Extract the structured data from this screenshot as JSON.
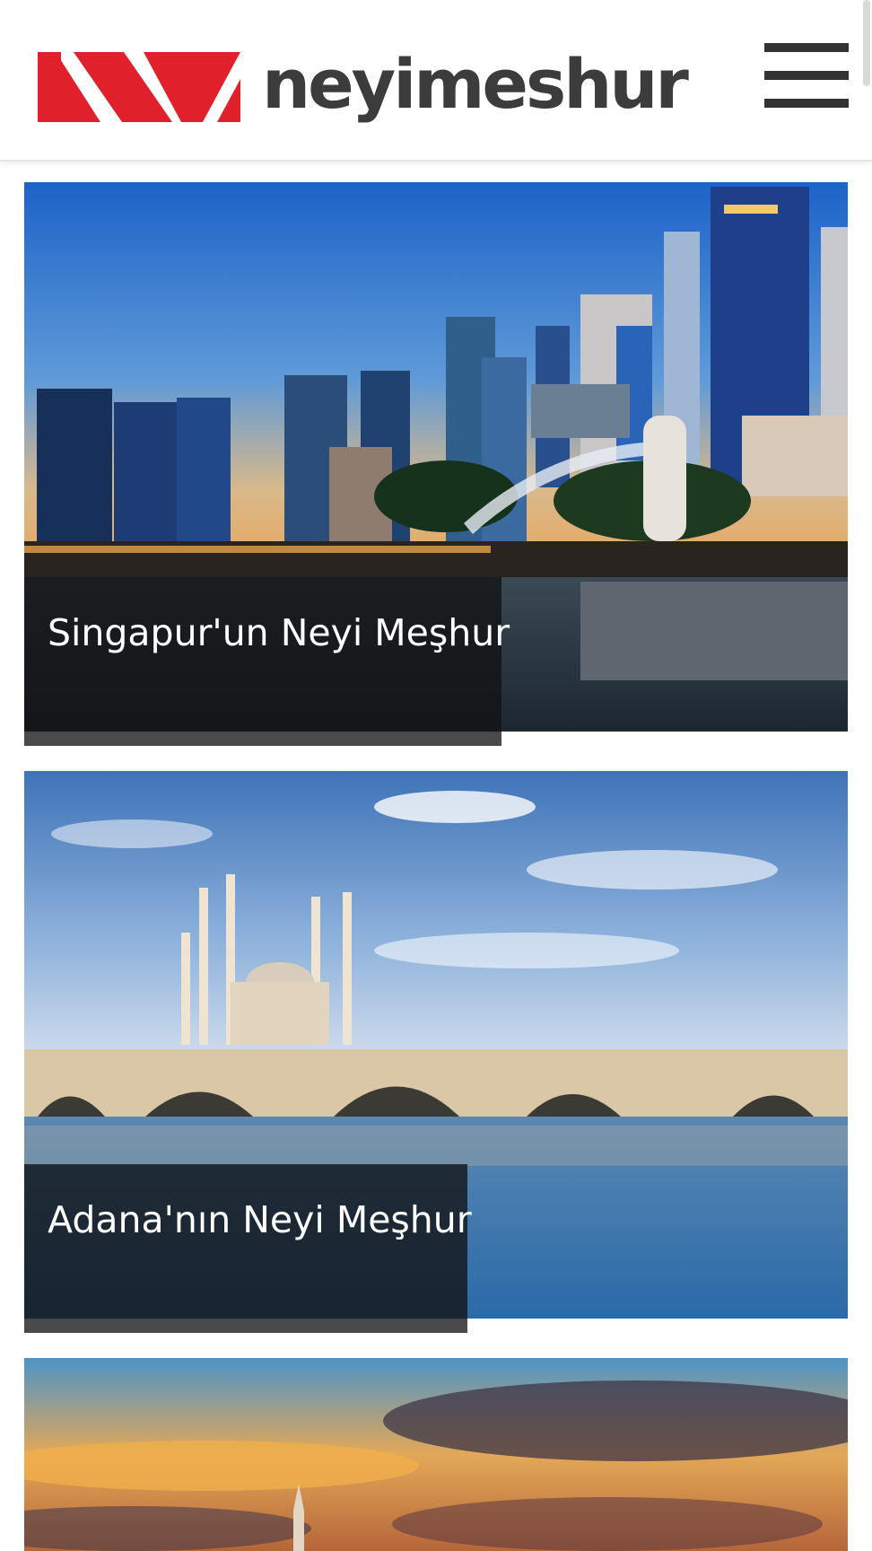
{
  "site": {
    "name": "neyimeshur",
    "logo_icon": "nm-logo-icon",
    "brand_color": "#e0202a",
    "text_color": "#3c3c3c",
    "menu_icon": "hamburger-menu-icon"
  },
  "articles": [
    {
      "title": "Singapur'un Neyi Meşhur"
    },
    {
      "title": "Adana'nın Neyi Meşhur"
    }
  ]
}
